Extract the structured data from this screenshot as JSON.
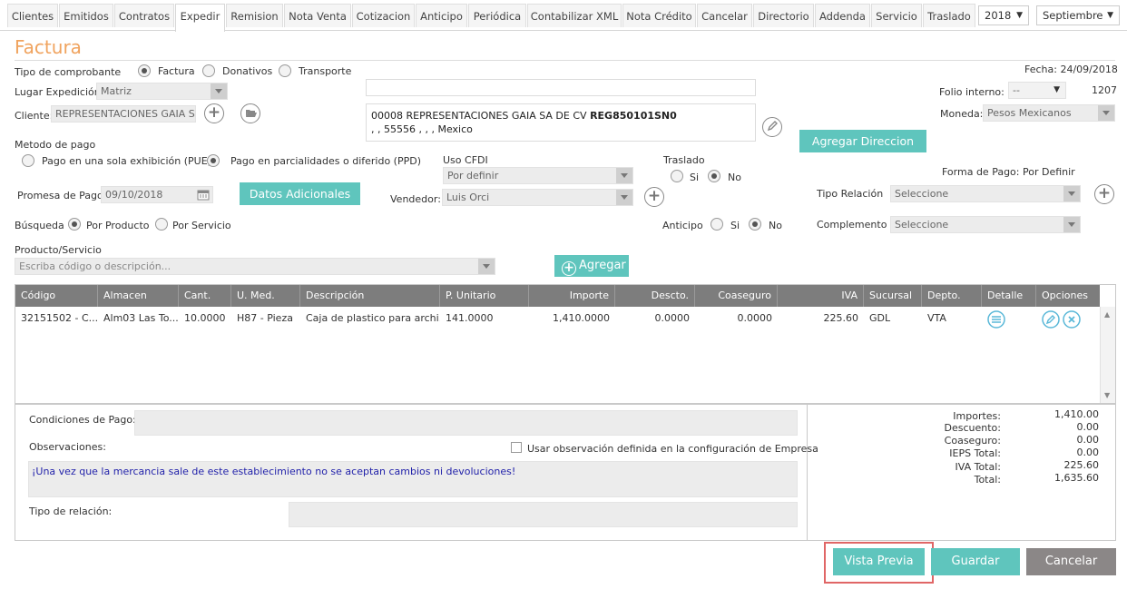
{
  "nav": {
    "tabs": [
      "Clientes",
      "Emitidos",
      "Contratos",
      "Expedir",
      "Remision",
      "Nota Venta",
      "Cotizacion",
      "Anticipo",
      "Periódica",
      "Contabilizar XML",
      "Nota Crédito",
      "Cancelar",
      "Directorio",
      "Addenda",
      "Servicio",
      "Traslado"
    ],
    "active_tab": "Expedir",
    "year": "2018",
    "month": "Septiembre"
  },
  "page": {
    "title": "Factura"
  },
  "form": {
    "tipo_comprobante_label": "Tipo de comprobante",
    "tipo_options": [
      "Factura",
      "Donativos",
      "Transporte"
    ],
    "tipo_selected": "Factura",
    "lugar_expedicion_label": "Lugar Expedición",
    "lugar_expedicion_value": "Matriz",
    "cliente_label": "Cliente:",
    "cliente_value": "REPRESENTACIONES GAIA SA D",
    "address_line1_prefix": "00008 REPRESENTACIONES GAIA SA DE CV ",
    "address_rfc": "REG850101SN0",
    "address_line2": ", , 55556 , , , Mexico",
    "fecha_label": "Fecha:",
    "fecha_value": "24/09/2018",
    "folio_label": "Folio interno:",
    "folio_select": "--",
    "folio_value": "1207",
    "moneda_label": "Moneda:",
    "moneda_value": "Pesos Mexicanos",
    "agregar_direccion": "Agregar Direccion",
    "metodo_pago_label": "Metodo de pago",
    "metodo_options": [
      "Pago en una sola exhibición (PUE)",
      "Pago en parcialidades o diferido (PPD)"
    ],
    "metodo_selected": "Pago en parcialidades o diferido (PPD)",
    "uso_cfdi_label": "Uso CFDI",
    "uso_cfdi_value": "Por definir",
    "traslado_label": "Traslado",
    "si_label": "Si",
    "no_label": "No",
    "forma_pago_label": "Forma de Pago: Por Definir",
    "promesa_label": "Promesa de Pago",
    "promesa_value": "09/10/2018",
    "datos_adicionales": "Datos Adicionales",
    "vendedor_label": "Vendedor:",
    "vendedor_value": "Luis Orci",
    "tipo_relacion_label": "Tipo Relación",
    "tipo_relacion_value": "Seleccione",
    "busqueda_label": "Búsqueda",
    "busqueda_options": [
      "Por Producto",
      "Por Servicio"
    ],
    "anticipo_label": "Anticipo",
    "complemento_label": "Complemento",
    "complemento_value": "Seleccione",
    "producto_label": "Producto/Servicio",
    "producto_placeholder": "Escriba código o descripción...",
    "agregar_label": "Agregar"
  },
  "grid": {
    "columns": [
      "Código",
      "Almacen",
      "Cant.",
      "U. Med.",
      "Descripción",
      "P. Unitario",
      "Importe",
      "Descto.",
      "Coaseguro",
      "IVA",
      "Sucursal",
      "Depto.",
      "Detalle",
      "Opciones"
    ],
    "rows": [
      [
        "32151502 - C...",
        "Alm03 Las To...",
        "10.0000",
        "H87 - Pieza",
        "Caja de plastico para archi...",
        "141.0000",
        "1,410.0000",
        "0.0000",
        "0.0000",
        "225.60",
        "GDL",
        "VTA"
      ]
    ]
  },
  "bottom": {
    "condiciones_label": "Condiciones de Pago:",
    "observaciones_label": "Observaciones:",
    "usar_obs_label": "Usar observación definida en la configuración de Empresa",
    "observacion_text": "¡Una vez que la mercancia sale de este establecimiento no se aceptan cambios ni devoluciones!",
    "tipo_relacion_label": "Tipo de relación:"
  },
  "totals": {
    "labels": [
      "Importes:",
      "Descuento:",
      "Coaseguro:",
      "IEPS Total:",
      "IVA Total:",
      "Total:"
    ],
    "values": [
      "1,410.00",
      "0.00",
      "0.00",
      "0.00",
      "225.60",
      "1,635.60"
    ]
  },
  "actions": {
    "vista_previa": "Vista Previa",
    "guardar": "Guardar",
    "cancelar": "Cancelar"
  },
  "colors": {
    "accent": "#5fc5bd",
    "title": "#f0a35e",
    "highlight_border": "#e06666",
    "cancel": "#8b8787"
  }
}
